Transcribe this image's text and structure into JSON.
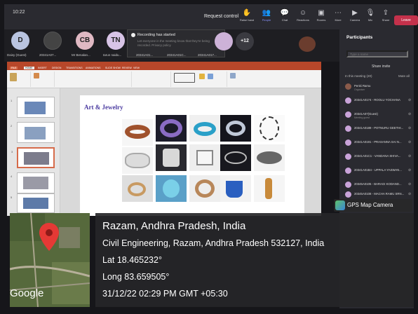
{
  "topbar": {
    "time": "10:22",
    "request_control": "Request control",
    "buttons": [
      {
        "icon": "hand-icon",
        "label": "Raise hand"
      },
      {
        "icon": "people-icon",
        "label": "People"
      },
      {
        "icon": "chat-icon",
        "label": "Chat"
      },
      {
        "icon": "reactions-icon",
        "label": "Reactions"
      },
      {
        "icon": "rooms-icon",
        "label": "Rooms"
      },
      {
        "icon": "more-icon",
        "label": "More"
      },
      {
        "icon": "camera-icon",
        "label": "Camera"
      },
      {
        "icon": "mic-icon",
        "label": "Mic"
      },
      {
        "icon": "share-icon",
        "label": "Share"
      }
    ],
    "leave_label": "Leave"
  },
  "strip": {
    "participants": [
      {
        "initials": "D",
        "name": "Daisy (Guest)",
        "color": "#b9c4e0"
      },
      {
        "initials": "",
        "name": "20341A07...",
        "color": "#333"
      },
      {
        "initials": "CB",
        "name": "Mr Benalan...",
        "color": "#e0b9c3"
      },
      {
        "initials": "TN",
        "name": "tarun naidu...",
        "color": "#d8c4e6"
      }
    ],
    "more_count": "+12",
    "rec_title": "Recording has started",
    "rec_desc": "Let everyone in the meeting know that they're being recorded. Privacy policy",
    "row2_names": [
      "20341A01...",
      "20341A01C...",
      "20341A017..."
    ]
  },
  "ppt": {
    "tabs": [
      "FILE",
      "HOME",
      "INSERT",
      "DESIGN",
      "TRANSITIONS",
      "ANIMATIONS",
      "SLIDE SHOW",
      "REVIEW",
      "VIEW"
    ],
    "slide_title": "Art & Jewelry",
    "thumb_numbers": [
      "1",
      "2",
      "3",
      "4",
      "5"
    ]
  },
  "panel": {
    "header": "Participants",
    "search_placeholder": "Type a name",
    "share_invite": "Share invite",
    "in_meeting": "In this meeting (20)",
    "more_label": "Mute all",
    "people": [
      {
        "name": "Penki Ramu",
        "sub": "Organiser"
      },
      {
        "name": "20341A0174 - ROOLU YOCHANA",
        "sub": ""
      },
      {
        "name": "20341A07(Guest)",
        "sub": "Meeting guest"
      },
      {
        "name": "20341A0189 - POTNURU GEETHI...",
        "sub": ""
      },
      {
        "name": "20341A0191 - PRASANNA SAI N...",
        "sub": ""
      },
      {
        "name": "20341A01C1 - VANDANA SHIVA...",
        "sub": ""
      },
      {
        "name": "20341A01B4 - UPPALA YASWAN...",
        "sub": ""
      },
      {
        "name": "20345A0105 - BARAGI KODAND...",
        "sub": ""
      },
      {
        "name": "20345A0108 - MACHA RAMU SRN...",
        "sub": ""
      }
    ]
  },
  "gps": {
    "badge": "GPS Map Camera",
    "place": "Razam, Andhra Pradesh, India",
    "address": "Civil Engineering, Razam, Andhra Pradesh 532127, India",
    "lat": "Lat 18.465232°",
    "long": "Long 83.659505°",
    "datetime": "31/12/22 02:29 PM GMT +05:30",
    "map_brand": "Google"
  }
}
